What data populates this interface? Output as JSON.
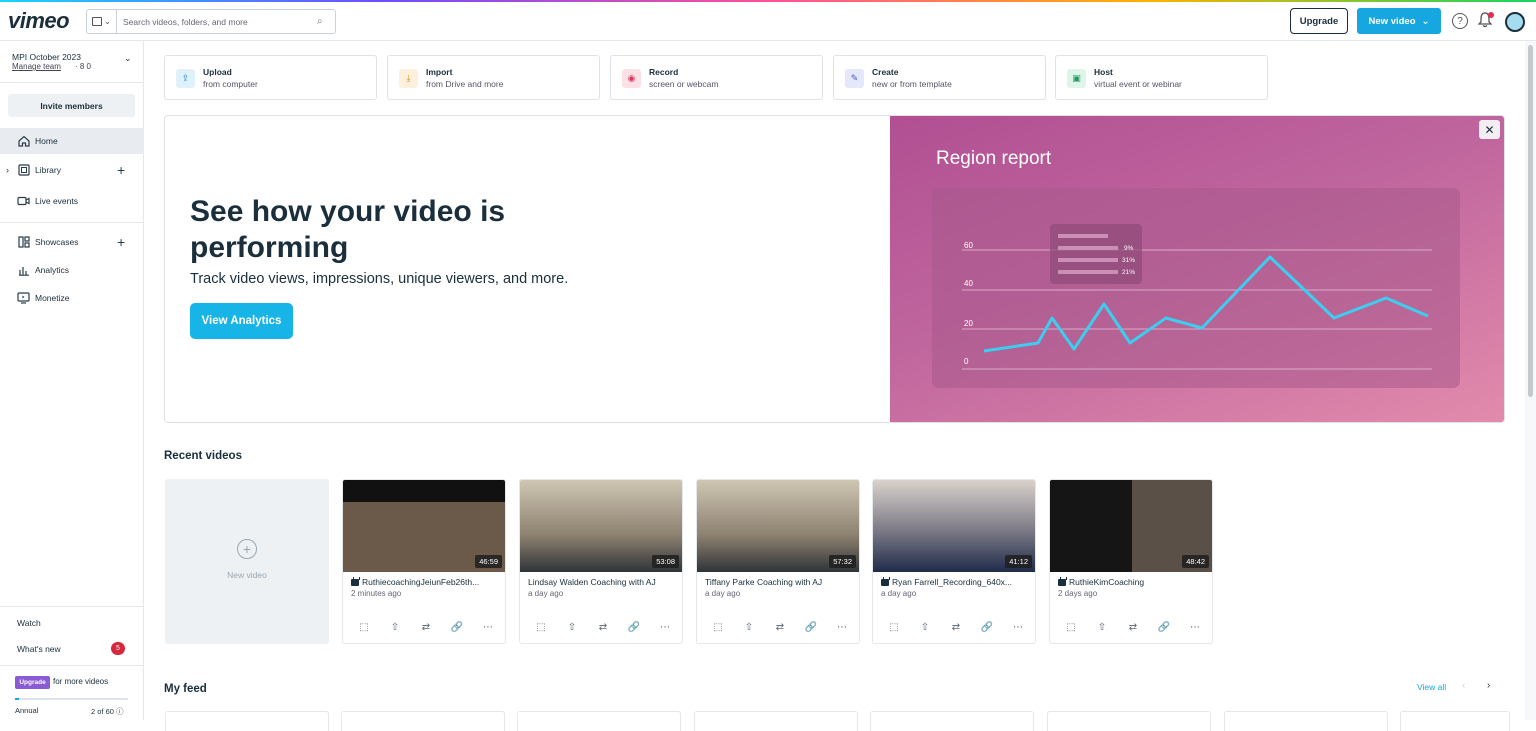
{
  "header": {
    "logo": "vimeo",
    "search_placeholder": "Search videos, folders, and more",
    "upgrade_label": "Upgrade",
    "new_video_label": "New video"
  },
  "sidebar": {
    "team_name": "MPI October 2023",
    "manage_team": "Manage team",
    "seats": "· 8 0",
    "invite_label": "Invite members",
    "nav": [
      {
        "label": "Home",
        "icon": "home-icon",
        "active": true
      },
      {
        "label": "Library",
        "icon": "library-icon"
      },
      {
        "label": "Live events",
        "icon": "camera-icon"
      },
      {
        "label": "Showcases",
        "icon": "showcase-icon"
      },
      {
        "label": "Analytics",
        "icon": "bar-chart-icon"
      },
      {
        "label": "Monetize",
        "icon": "monetize-icon"
      }
    ],
    "watch": "Watch",
    "whats_new": "What's new",
    "whats_new_count": "5",
    "upgrade_tag": "Upgrade",
    "upgrade_text": "for more videos",
    "plan": "Annual",
    "usage": "2 of 60",
    "usage_fraction": 0.033
  },
  "quick_actions": [
    {
      "title": "Upload",
      "subtitle": "from computer",
      "icon": "upload-icon",
      "color": "#dff2fb",
      "fg": "#1a8bc0"
    },
    {
      "title": "Import",
      "subtitle": "from Drive and more",
      "icon": "import-icon",
      "color": "#fdf0dc",
      "fg": "#d48a1c"
    },
    {
      "title": "Record",
      "subtitle": "screen or webcam",
      "icon": "record-icon",
      "color": "#fbe1e6",
      "fg": "#d23a5a"
    },
    {
      "title": "Create",
      "subtitle": "new or from template",
      "icon": "create-icon",
      "color": "#e5e7fb",
      "fg": "#4a55c8"
    },
    {
      "title": "Host",
      "subtitle": "virtual event or webinar",
      "icon": "host-icon",
      "color": "#dff5ea",
      "fg": "#1f9a5a"
    }
  ],
  "banner": {
    "heading": "See how your video is performing",
    "subheading": "Track video views, impressions, unique viewers, and more.",
    "cta": "View Analytics",
    "art_title": "Region report",
    "chart_ticks": [
      "60",
      "40",
      "20",
      "0"
    ],
    "legend_values": [
      "9%",
      "31%",
      "21%"
    ]
  },
  "recent": {
    "title": "Recent videos",
    "new_video": "New video",
    "videos": [
      {
        "title": "RuthiecoachingJeiunFeb26th...",
        "time": "2 minutes ago",
        "duration": "46:59",
        "locked": true
      },
      {
        "title": "Lindsay Walden Coaching with AJ",
        "time": "a day ago",
        "duration": "53:08",
        "locked": false
      },
      {
        "title": "Tiffany Parke Coaching with AJ",
        "time": "a day ago",
        "duration": "57:32",
        "locked": false
      },
      {
        "title": "Ryan Farrell_Recording_640x...",
        "time": "a day ago",
        "duration": "41:12",
        "locked": true
      },
      {
        "title": "RuthieKimCoaching",
        "time": "2 days ago",
        "duration": "48:42",
        "locked": true
      }
    ]
  },
  "feed": {
    "title": "My feed",
    "view_all": "View all"
  }
}
